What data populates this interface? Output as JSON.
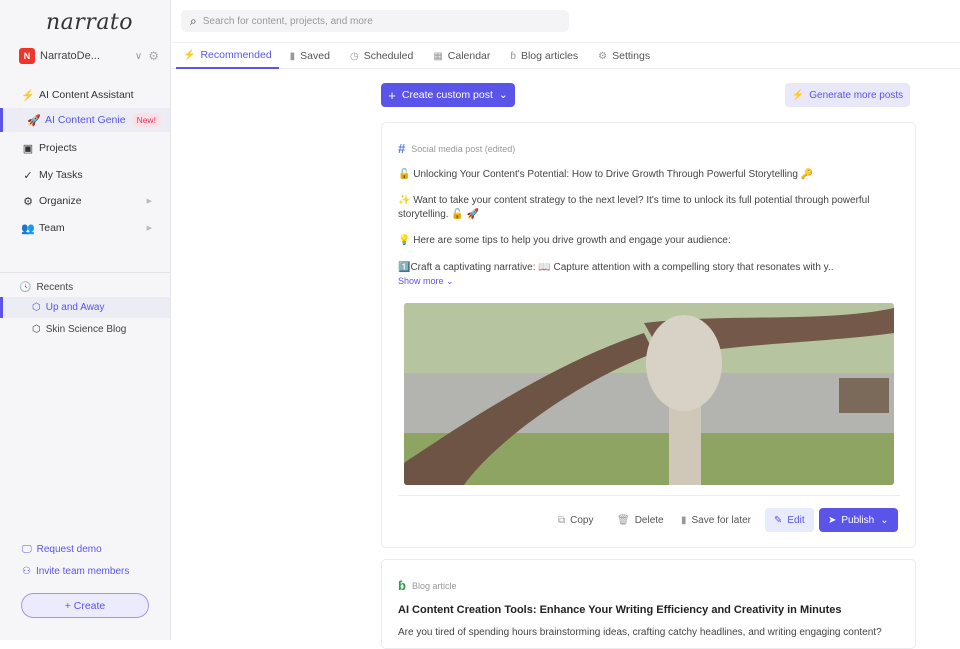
{
  "brand": {
    "logo": "narrato"
  },
  "workspace": {
    "initial": "N",
    "name": "NarratoDe..."
  },
  "sidebar": {
    "items": [
      {
        "label": "AI Content Assistant",
        "icon": "lightning-icon"
      },
      {
        "label": "AI Content Genie",
        "icon": "rocket-icon",
        "badge": "New!"
      },
      {
        "label": "Projects",
        "icon": "briefcase-icon"
      },
      {
        "label": "My Tasks",
        "icon": "checks-icon"
      },
      {
        "label": "Organize",
        "icon": "gears-icon"
      },
      {
        "label": "Team",
        "icon": "team-icon"
      }
    ],
    "recents_label": "Recents",
    "recents": [
      "Up and Away",
      "Skin Science Blog"
    ],
    "request_demo": "Request demo",
    "invite": "Invite team members",
    "create": "+ Create"
  },
  "search": {
    "placeholder": "Search for content, projects, and more"
  },
  "tabs": [
    "Recommended",
    "Saved",
    "Scheduled",
    "Calendar",
    "Blog articles",
    "Settings"
  ],
  "toolbar": {
    "create_custom": "Create custom post",
    "generate": "Generate more posts"
  },
  "post": {
    "type": "Social media post (edited)",
    "lines": [
      "🔓 Unlocking Your Content's Potential: How to Drive Growth Through Powerful Storytelling 🔑",
      "✨ Want to take your content strategy to the next level? It's time to unlock its full potential through powerful storytelling. 🔓 🚀",
      "💡 Here are some tips to help you drive growth and engage your audience:",
      "1️⃣Craft a captivating narrative: 📖 Capture attention with a compelling story that resonates with y.."
    ],
    "show_more": "Show more ⌄",
    "actions": {
      "copy": "Copy",
      "delete": "Delete",
      "save": "Save for later",
      "edit": "Edit",
      "publish": "Publish"
    }
  },
  "blog": {
    "type": "Blog article",
    "title": "AI Content Creation Tools: Enhance Your Writing Efficiency and Creativity in Minutes",
    "excerpt": "Are you tired of spending hours brainstorming ideas, crafting catchy headlines, and writing engaging content?"
  },
  "colors": {
    "accent": "#5a55e8"
  }
}
